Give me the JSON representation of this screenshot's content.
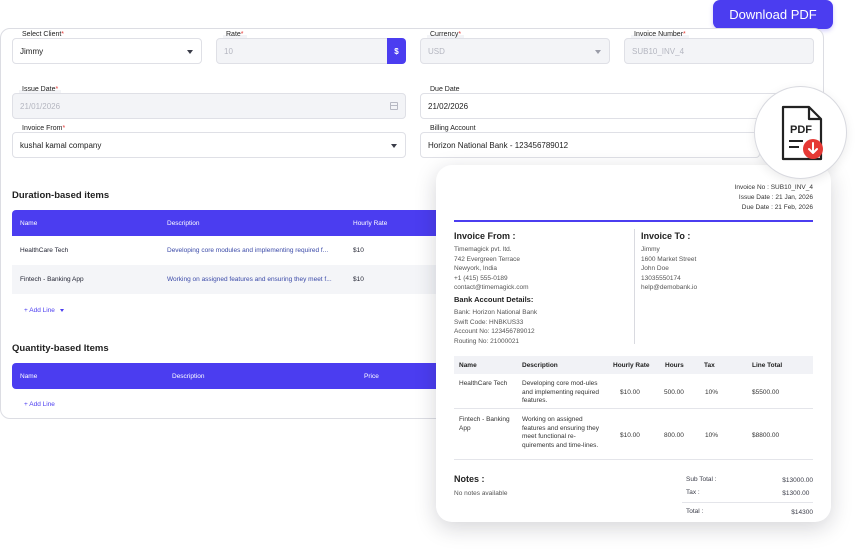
{
  "header": {
    "download_label": "Download PDF"
  },
  "form": {
    "client": {
      "label": "Select Client",
      "required": "*",
      "value": "Jimmy"
    },
    "rate": {
      "label": "Rate",
      "required": "*",
      "value": "10",
      "currency_symbol": "$"
    },
    "currency": {
      "label": "Currency",
      "required": "*",
      "value": "USD"
    },
    "invoice_number": {
      "label": "Invoice Number",
      "required": "*",
      "value": "SUB10_INV_4"
    },
    "issue_date": {
      "label": "Issue Date",
      "required": "*",
      "value": "21/01/2026"
    },
    "due_date": {
      "label": "Due Date",
      "value": "21/02/2026"
    },
    "invoice_from": {
      "label": "Invoice From",
      "required": "*",
      "value": "kushal kamal company"
    },
    "billing_account": {
      "label": "Billing Account",
      "value": "Horizon National Bank - 123456789012"
    }
  },
  "duration_section": {
    "title": "Duration-based items",
    "columns": [
      "Name",
      "Description",
      "Hourly Rate"
    ],
    "rows": [
      {
        "name": "HealthCare Tech",
        "description": "Developing core modules and implementing required f...",
        "rate": "$10"
      },
      {
        "name": "Fintech - Banking App",
        "description": "Working on assigned features and ensuring they meet f...",
        "rate": "$10"
      }
    ],
    "add_line": "+ Add Line"
  },
  "quantity_section": {
    "title": "Quantity-based Items",
    "columns": [
      "Name",
      "Description",
      "Price"
    ],
    "add_line": "+ Add Line"
  },
  "preview": {
    "invoice_no_label": "Invoice No :",
    "invoice_no": "SUB10_INV_4",
    "issue_date_label": "Issue Date :",
    "issue_date": "21 Jan, 2026",
    "due_date_label": "Due Date :",
    "due_date": "21 Feb, 2026",
    "from_title": "Invoice From :",
    "from_lines": [
      "Timemagick pvt. ltd.",
      "742 Evergreen Terrace",
      "Newyork, India",
      "+1 (415) 555-0189",
      "contact@timemagick.com"
    ],
    "bank_title": "Bank Account Details:",
    "bank_lines": [
      "Bank: Horizon National Bank",
      "Swift Code: HNBKUS33",
      "Account No: 123456789012",
      "Routing No: 21000021"
    ],
    "to_title": "Invoice To :",
    "to_lines": [
      "Jimmy",
      "1600 Market Street",
      "John Doe",
      "13035550174",
      "help@demobank.io"
    ],
    "columns": [
      "Name",
      "Description",
      "Hourly Rate",
      "Hours",
      "Tax",
      "Line Total"
    ],
    "rows": [
      {
        "name": "HealthCare Tech",
        "description": "Developing core mod-ules and implementing required features.",
        "rate": "$10.00",
        "hours": "500.00",
        "tax": "10%",
        "total": "$5500.00"
      },
      {
        "name": "Fintech - Banking App",
        "description": "Working on assigned features and ensuring they meet functional re-quirements and time-lines.",
        "rate": "$10.00",
        "hours": "800.00",
        "tax": "10%",
        "total": "$8800.00"
      }
    ],
    "notes_title": "Notes :",
    "notes_value": "No notes available",
    "subtotal_label": "Sub Total :",
    "subtotal": "$13000.00",
    "tax_label": "Tax :",
    "tax": "$1300.00",
    "total_label": "Total :",
    "total": "$14300"
  },
  "pdf_badge": {
    "text": "PDF",
    "icon": "pdf-download-icon",
    "accent": "#e53935"
  },
  "colors": {
    "accent": "#4b3df0"
  }
}
